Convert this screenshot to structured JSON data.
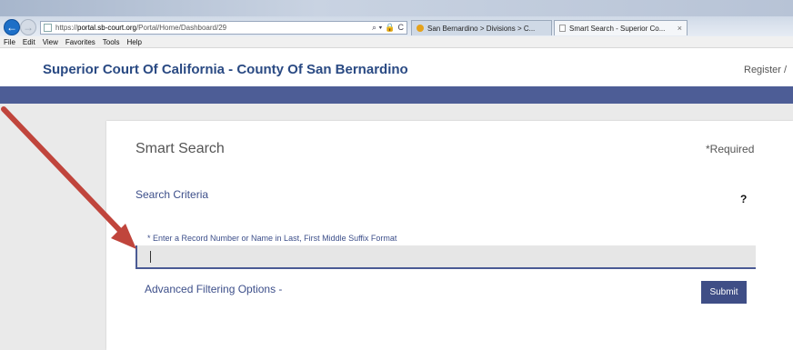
{
  "browser": {
    "url_prefix": "https://",
    "url_host": "portal.sb-court.org",
    "url_path": "/Portal/Home/Dashboard/29",
    "address_tools": [
      "⌕ ▾",
      "🔒",
      "C"
    ],
    "tabs": [
      {
        "label": "San Bernardino > Divisions > C...",
        "active": false
      },
      {
        "label": "Smart Search - Superior Co...",
        "active": true,
        "close": "×"
      }
    ],
    "menu": [
      "File",
      "Edit",
      "View",
      "Favorites",
      "Tools",
      "Help"
    ]
  },
  "header": {
    "site_title": "Superior Court Of California - County Of San Bernardino",
    "register_label": "Register /"
  },
  "search_panel": {
    "title": "Smart Search",
    "required_note": "*Required",
    "criteria_label": "Search Criteria",
    "help_icon": "?",
    "field_label": "* Enter a Record Number or Name in Last, First Middle Suffix Format",
    "input_value": "",
    "advanced_label": "Advanced Filtering Options -",
    "submit_label": "Submit"
  },
  "colors": {
    "brand_blue": "#2a4a83",
    "nav_band": "#4d5d96",
    "submit_bg": "#3f4e86",
    "arrow": "#c0453c"
  }
}
